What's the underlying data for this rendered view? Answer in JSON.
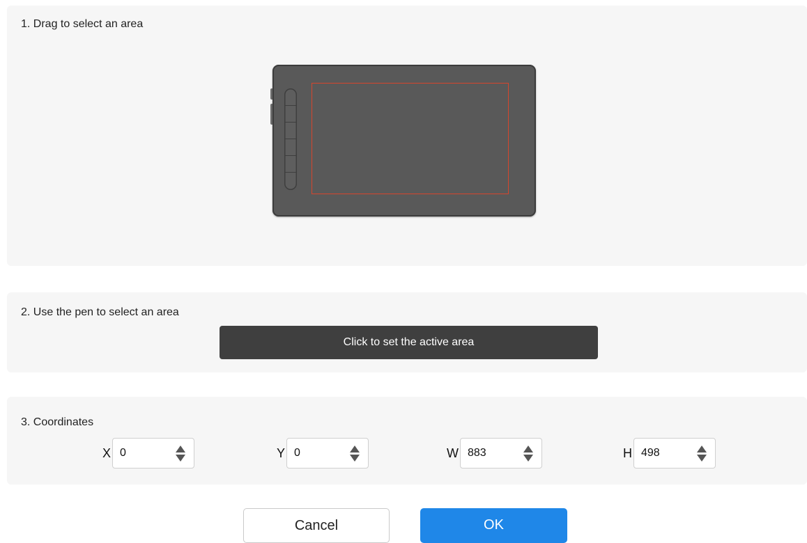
{
  "drag_section": {
    "title": "1. Drag to select an area"
  },
  "pen_section": {
    "title": "2. Use the pen to select an area",
    "button_label": "Click to set the active area"
  },
  "coords_section": {
    "title": "3. Coordinates",
    "fields": [
      {
        "label": "X",
        "value": "0"
      },
      {
        "label": "Y",
        "value": "0"
      },
      {
        "label": "W",
        "value": "883"
      },
      {
        "label": "H",
        "value": "498"
      }
    ]
  },
  "actions": {
    "cancel_label": "Cancel",
    "ok_label": "OK"
  },
  "colors": {
    "panel_bg": "#f6f6f6",
    "tablet_body": "#595959",
    "active_area_border": "#d6452d",
    "pen_button_bg": "#3f3f3f",
    "ok_button_bg": "#1f87e8"
  }
}
